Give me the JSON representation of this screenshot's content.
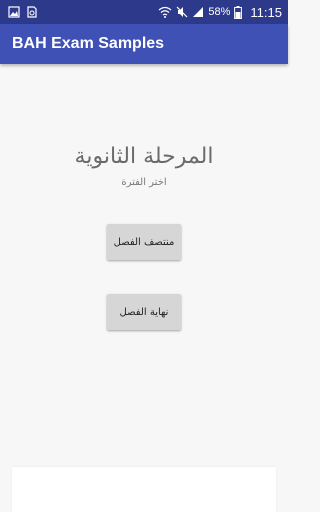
{
  "status_bar": {
    "icons_left": [
      "image-icon",
      "file-sync-icon"
    ],
    "icons_right": [
      "wifi-icon",
      "mute-icon",
      "signal-icon",
      "battery-icon"
    ],
    "battery": "58%",
    "time": "11:15"
  },
  "app_bar": {
    "title": "BAH Exam Samples",
    "color": "#3f51b5"
  },
  "main": {
    "heading": "المرحلة الثانوية",
    "subheading": "اختر الفترة",
    "buttons": [
      {
        "label": "منتصف الفصل"
      },
      {
        "label": "نهاية الفصل"
      }
    ]
  }
}
